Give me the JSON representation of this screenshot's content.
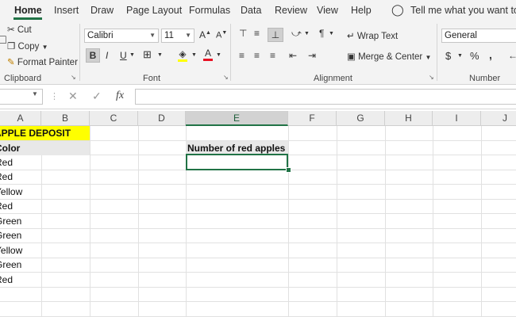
{
  "ribbon_tabs": [
    "Home",
    "Insert",
    "Draw",
    "Page Layout",
    "Formulas",
    "Data",
    "Review",
    "View",
    "Help"
  ],
  "tell_me": "Tell me what you want to d",
  "clipboard": {
    "cut": "Cut",
    "copy": "Copy",
    "format_painter": "Format Painter",
    "group": "Clipboard"
  },
  "font": {
    "name": "Calibri",
    "size": "11",
    "grow": "A",
    "shrink": "A",
    "bold": "B",
    "italic": "I",
    "underline": "U",
    "color_letter": "A",
    "group": "Font",
    "font_color": "#e81123",
    "fill_color": "#ffff00"
  },
  "alignment": {
    "wrap_text": "Wrap Text",
    "merge_center": "Merge & Center",
    "group": "Alignment"
  },
  "number": {
    "format": "General",
    "currency": "$",
    "percent": "%",
    "comma": ",",
    "group": "Number"
  },
  "formula_bar": {
    "fx": "fx"
  },
  "columns": [
    "A",
    "B",
    "C",
    "D",
    "E",
    "F",
    "G",
    "H",
    "I",
    "J"
  ],
  "cells": {
    "a1": "APPLE DEPOSIT",
    "a2": "Color",
    "colors": [
      "Red",
      "Red",
      "Yellow",
      "Red",
      "Green",
      "Green",
      "Yellow",
      "Green",
      "Red"
    ],
    "e2": "Number of red apples"
  },
  "highlight_color": "#ffff00",
  "accent_color": "#217346"
}
